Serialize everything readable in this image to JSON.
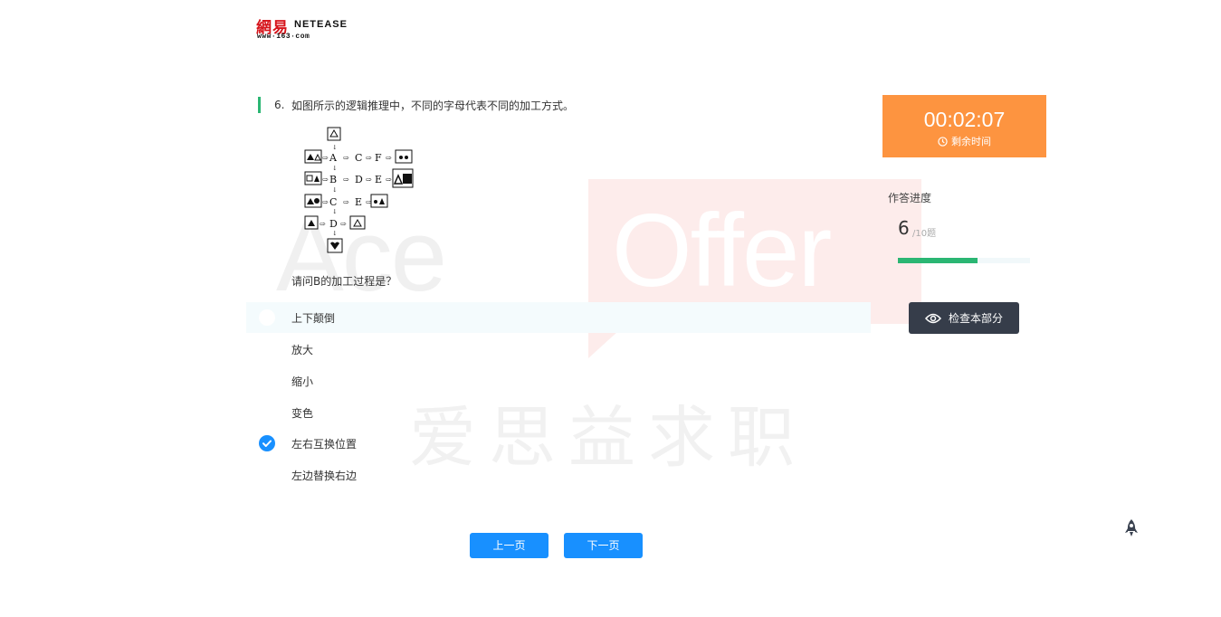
{
  "logo": {
    "cn": "網易",
    "en": "NETEASE",
    "url": "www·163·com"
  },
  "watermark": {
    "ace": "Ace",
    "offer": "Offer",
    "cn": "爱思益求职"
  },
  "question": {
    "number": "6.",
    "text": "如图所示的逻辑推理中，不同的字母代表不同的加工方式。",
    "sub": "请问B的加工过程是？",
    "diagram_letters": [
      "A",
      "C",
      "F",
      "B",
      "D",
      "E",
      "C",
      "E",
      "D"
    ]
  },
  "options": [
    {
      "label": "上下颠倒",
      "selected": false
    },
    {
      "label": "放大",
      "selected": false
    },
    {
      "label": "缩小",
      "selected": false
    },
    {
      "label": "变色",
      "selected": false
    },
    {
      "label": "左右互换位置",
      "selected": true
    },
    {
      "label": "左边替换右边",
      "selected": false
    }
  ],
  "nav": {
    "prev": "上一页",
    "next": "下一页"
  },
  "timer": {
    "time": "00:02:07",
    "label": "剩余时间"
  },
  "progress": {
    "label": "作答进度",
    "current": "6",
    "total": "/10题",
    "fraction": 0.6
  },
  "check_button": "检查本部分",
  "colors": {
    "accent": "#1890ff",
    "timer": "#fd9440",
    "progress": "#2bb673",
    "dark_button": "#363d4a"
  }
}
